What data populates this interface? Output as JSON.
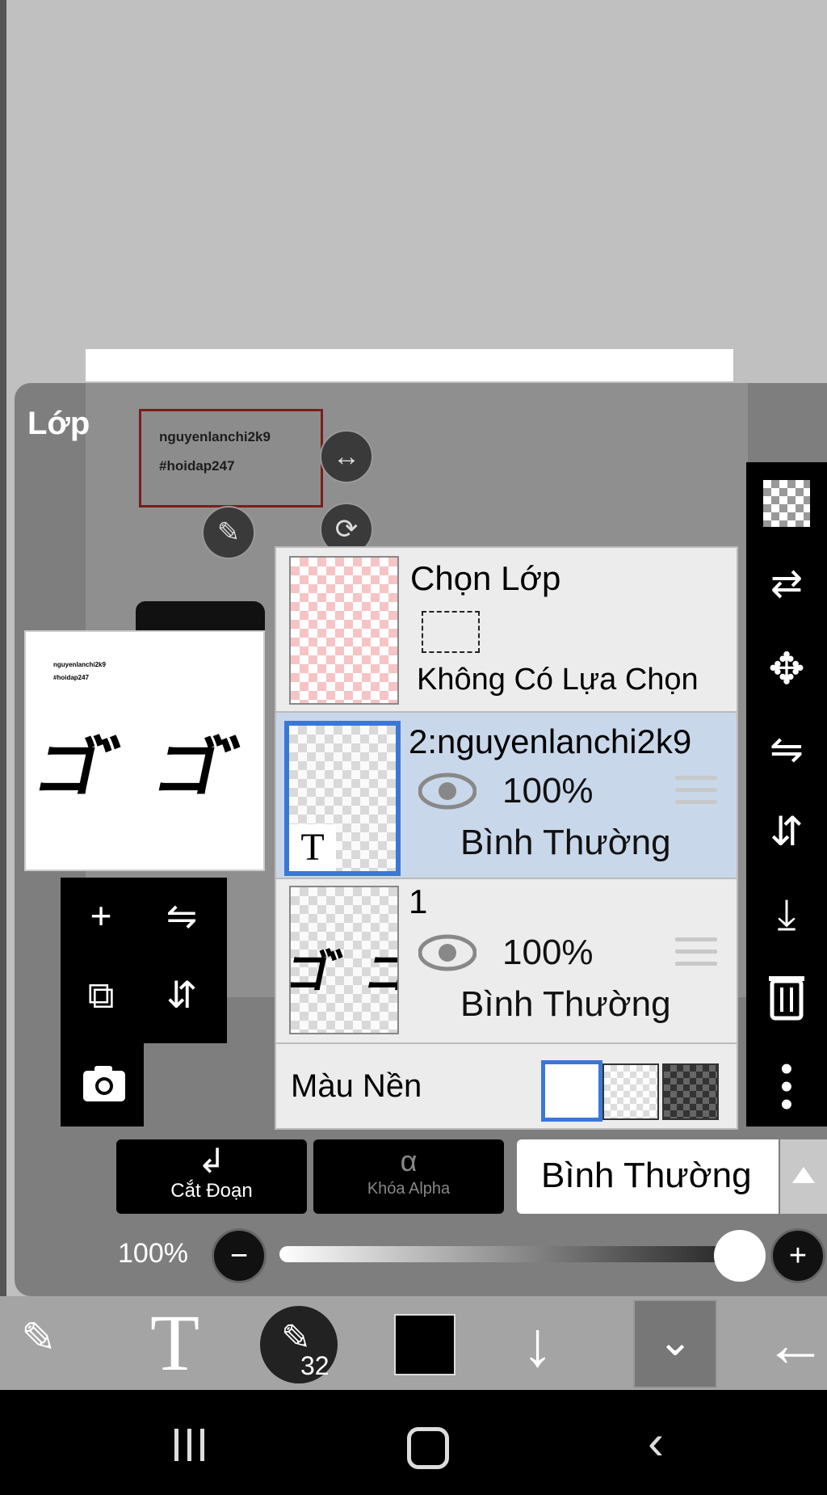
{
  "panel": {
    "title": "Lớp"
  },
  "canvas_text": {
    "line1": "nguyenlanchi2k9",
    "line2": "#hoidap247"
  },
  "preview": {
    "line1": "nguyenlanchi2k9",
    "line2": "#hoidap247",
    "art_text": "ゴ゛ゴ゛ゴ゛"
  },
  "selection_row": {
    "title": "Chọn Lớp",
    "subtitle": "Không Có Lựa Chọn"
  },
  "layers": [
    {
      "name": "2:nguyenlanchi2k9",
      "opacity": "100%",
      "blend": "Bình Thường",
      "selected": true,
      "thumb_icon": "T"
    },
    {
      "name": "1",
      "opacity": "100%",
      "blend": "Bình Thường",
      "selected": false,
      "thumb_art": "ゴ゛ゴ゛ゴ゛"
    }
  ],
  "background": {
    "label": "Màu Nền"
  },
  "buttons": {
    "clip": "Cắt Đoạn",
    "alpha_lock": "Khóa Alpha",
    "blend_mode": "Bình Thường"
  },
  "opacity_slider": {
    "label": "100%",
    "value": 1.0
  },
  "brush": {
    "size": "32"
  },
  "colors": {
    "selected_layer_bg": "#c9d7ea",
    "selected_border": "#3a78d6",
    "current_color": "#000000"
  }
}
